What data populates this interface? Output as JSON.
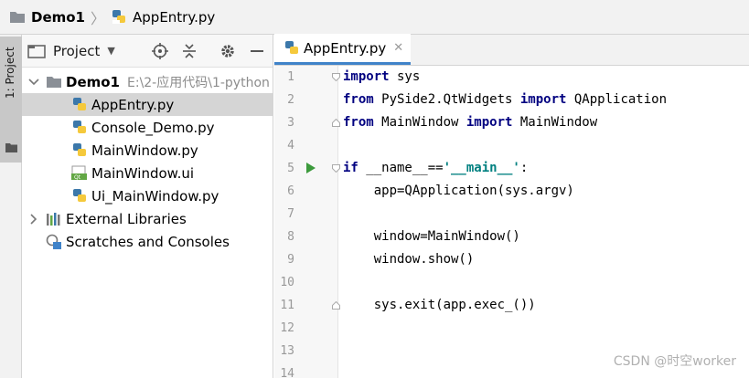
{
  "navbar": {
    "project_name": "Demo1",
    "file_name": "AppEntry.py"
  },
  "tool_stripe": {
    "project_tab_label": "1: Project"
  },
  "project_panel": {
    "title": "Project",
    "tree": [
      {
        "label": "Demo1",
        "path": "E:\\2-应用代码\\1-python",
        "type": "folder",
        "expanded": true,
        "level": 0,
        "bold": true
      },
      {
        "label": "AppEntry.py",
        "type": "python",
        "level": 1,
        "selected": true
      },
      {
        "label": "Console_Demo.py",
        "type": "python",
        "level": 1
      },
      {
        "label": "MainWindow.py",
        "type": "python",
        "level": 1
      },
      {
        "label": "MainWindow.ui",
        "type": "qt",
        "level": 1
      },
      {
        "label": "Ui_MainWindow.py",
        "type": "python",
        "level": 1
      },
      {
        "label": "External Libraries",
        "type": "libraries",
        "level": 0,
        "expanded": false
      },
      {
        "label": "Scratches and Consoles",
        "type": "scratches",
        "level": 0
      }
    ]
  },
  "editor": {
    "tab": {
      "label": "AppEntry.py",
      "close_glyph": "✕"
    },
    "line_numbers": [
      "1",
      "2",
      "3",
      "4",
      "5",
      "6",
      "7",
      "8",
      "9",
      "10",
      "11",
      "12",
      "13",
      "14"
    ],
    "lines": [
      [
        {
          "t": "import",
          "c": "kw"
        },
        {
          "t": " sys"
        }
      ],
      [
        {
          "t": "from",
          "c": "kw"
        },
        {
          "t": " PySide2.QtWidgets "
        },
        {
          "t": "import",
          "c": "kw"
        },
        {
          "t": " QApplication"
        }
      ],
      [
        {
          "t": "from",
          "c": "kw"
        },
        {
          "t": " MainWindow "
        },
        {
          "t": "import",
          "c": "kw"
        },
        {
          "t": " MainWindow"
        }
      ],
      [],
      [
        {
          "t": "if",
          "c": "kw"
        },
        {
          "t": " __name__=="
        },
        {
          "t": "'__main__'",
          "c": "str"
        },
        {
          "t": ":"
        }
      ],
      [
        {
          "t": "    app=QApplication(sys.argv)"
        }
      ],
      [],
      [
        {
          "t": "    window=MainWindow()"
        }
      ],
      [
        {
          "t": "    window.show()"
        }
      ],
      [],
      [
        {
          "t": "    sys.exit(app.exec_())"
        }
      ],
      [],
      [],
      []
    ]
  },
  "watermark": "CSDN @时空worker",
  "colors": {
    "keyword": "#000080",
    "string": "#008080",
    "tab_underline": "#4083c9",
    "selection": "#d5d5d5",
    "run_arrow": "#3c9a3c"
  }
}
